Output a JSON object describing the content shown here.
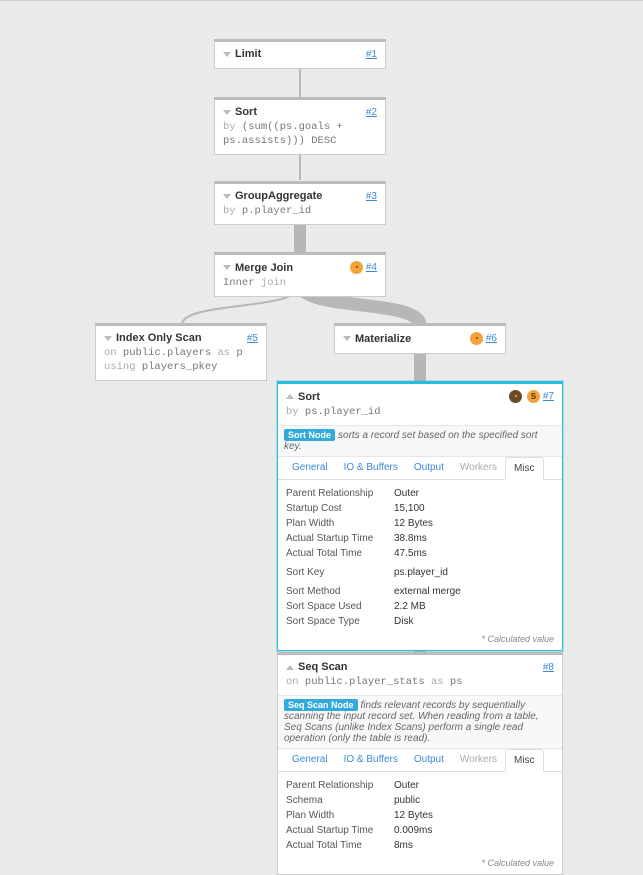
{
  "nodes": {
    "n1": {
      "title": "Limit",
      "link": "#1"
    },
    "n2": {
      "title": "Sort",
      "link": "#2",
      "sub_by": "by",
      "sub_expr": "(sum((ps.goals + ps.assists))) DESC"
    },
    "n3": {
      "title": "GroupAggregate",
      "link": "#3",
      "sub_by": "by",
      "sub_expr": "p.player_id"
    },
    "n4": {
      "title": "Merge Join",
      "link": "#4",
      "sub_kind": "Inner",
      "sub_join": "join",
      "badge": "clock"
    },
    "n5": {
      "title": "Index Only Scan",
      "link": "#5",
      "l1_kw": "on",
      "l1_v": "public.players",
      "l1_as": "as",
      "l1_alias": "p",
      "l2_kw": "using",
      "l2_v": "players_pkey"
    },
    "n6": {
      "title": "Materialize",
      "link": "#6",
      "badge": "clock"
    },
    "n7": {
      "title": "Sort",
      "link": "#7",
      "sub_by": "by",
      "sub_expr": "ps.player_id",
      "desc_tag": "Sort Node",
      "desc_text": "sorts a record set based on the specified sort key.",
      "tabs": {
        "general": "General",
        "io": "IO & Buffers",
        "output": "Output",
        "workers": "Workers",
        "misc": "Misc"
      },
      "details": [
        {
          "k": "Parent Relationship",
          "v": "Outer"
        },
        {
          "k": "Startup Cost",
          "v": "15,100"
        },
        {
          "k": "Plan Width",
          "v": "12 Bytes"
        },
        {
          "k": "Actual Startup Time",
          "v": "38.8ms"
        },
        {
          "k": "Actual Total Time",
          "v": "47.5ms"
        },
        {
          "k": "Sort Key",
          "v": " ps.player_id"
        },
        {
          "k": "Sort Method",
          "v": "external merge"
        },
        {
          "k": "Sort Space Used",
          "v": "2.2 MB"
        },
        {
          "k": "Sort Space Type",
          "v": "Disk"
        }
      ],
      "calc": "* Calculated value"
    },
    "n8": {
      "title": "Seq Scan",
      "link": "#8",
      "l1_kw": "on",
      "l1_v": "public.player_stats",
      "l1_as": "as",
      "l1_alias": "ps",
      "desc_tag": "Seq Scan Node",
      "desc_text": "finds relevant records by sequentially scanning the input record set. When reading from a table, Seq Scans (unlike Index Scans) perform a single read operation (only the table is read).",
      "tabs": {
        "general": "General",
        "io": "IO & Buffers",
        "output": "Output",
        "workers": "Workers",
        "misc": "Misc"
      },
      "details": [
        {
          "k": "Parent Relationship",
          "v": "Outer"
        },
        {
          "k": "Schema",
          "v": "public"
        },
        {
          "k": "Plan Width",
          "v": "12 Bytes"
        },
        {
          "k": "Actual Startup Time",
          "v": "0.009ms"
        },
        {
          "k": "Actual Total Time",
          "v": "8ms"
        }
      ],
      "calc": "* Calculated value"
    }
  },
  "badge_labels": {
    "clock": "◔",
    "s": "S"
  },
  "chart_data": {
    "type": "tree",
    "title": "Query Execution Plan",
    "nodes": [
      {
        "id": 1,
        "label": "Limit"
      },
      {
        "id": 2,
        "label": "Sort",
        "key": "(sum((ps.goals + ps.assists))) DESC"
      },
      {
        "id": 3,
        "label": "GroupAggregate",
        "key": "p.player_id"
      },
      {
        "id": 4,
        "label": "Merge Join",
        "join_type": "Inner"
      },
      {
        "id": 5,
        "label": "Index Only Scan",
        "relation": "public.players",
        "alias": "p",
        "index": "players_pkey"
      },
      {
        "id": 6,
        "label": "Materialize"
      },
      {
        "id": 7,
        "label": "Sort",
        "key": "ps.player_id",
        "selected": true,
        "misc": {
          "Parent Relationship": "Outer",
          "Startup Cost": 15100,
          "Plan Width Bytes": 12,
          "Actual Startup Time ms": 38.8,
          "Actual Total Time ms": 47.5,
          "Sort Key": "ps.player_id",
          "Sort Method": "external merge",
          "Sort Space Used MB": 2.2,
          "Sort Space Type": "Disk"
        }
      },
      {
        "id": 8,
        "label": "Seq Scan",
        "relation": "public.player_stats",
        "alias": "ps",
        "misc": {
          "Parent Relationship": "Outer",
          "Schema": "public",
          "Plan Width Bytes": 12,
          "Actual Startup Time ms": 0.009,
          "Actual Total Time ms": 8
        }
      }
    ],
    "edges": [
      {
        "from": 1,
        "to": 2,
        "weight": 1
      },
      {
        "from": 2,
        "to": 3,
        "weight": 1
      },
      {
        "from": 3,
        "to": 4,
        "weight": 3
      },
      {
        "from": 4,
        "to": 5,
        "weight": 1
      },
      {
        "from": 4,
        "to": 6,
        "weight": 3
      },
      {
        "from": 6,
        "to": 7,
        "weight": 3
      },
      {
        "from": 7,
        "to": 8,
        "weight": 3
      }
    ]
  }
}
